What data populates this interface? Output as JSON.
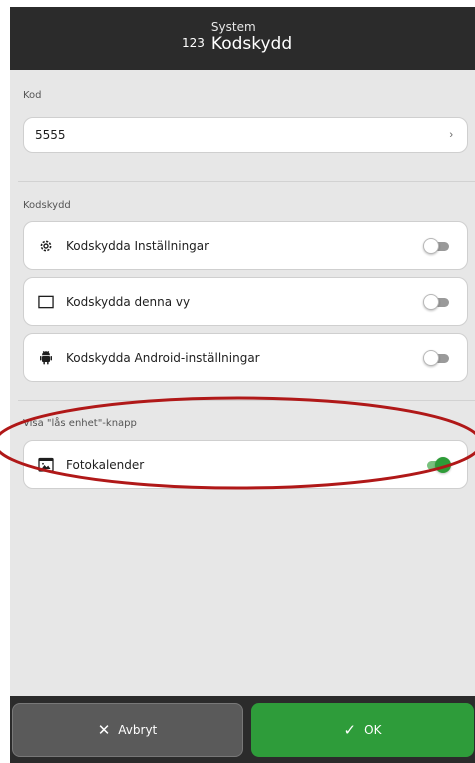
{
  "header": {
    "app_number": "123",
    "subtitle": "System",
    "title": "Kodskydd"
  },
  "code_section": {
    "label": "Kod",
    "value": "5555",
    "chevron": "›"
  },
  "protection_section": {
    "label": "Kodskydd",
    "items": [
      {
        "label": "Kodskydda Inställningar",
        "icon": "gear-icon",
        "enabled": false
      },
      {
        "label": "Kodskydda denna vy",
        "icon": "square-icon",
        "enabled": false
      },
      {
        "label": "Kodskydda Android-inställningar",
        "icon": "android-icon",
        "enabled": false
      }
    ]
  },
  "lock_button_section": {
    "label": "Visa \"lås enhet\"-knapp",
    "items": [
      {
        "label": "Fotokalender",
        "icon": "photo-calendar-icon",
        "enabled": true
      }
    ]
  },
  "footer": {
    "cancel_label": "Avbryt",
    "ok_label": "OK"
  },
  "colors": {
    "accent_green": "#2e9c3a",
    "annotation_red": "#b01818",
    "header_bg": "#2b2b2b",
    "content_bg": "#e7e7e7"
  }
}
